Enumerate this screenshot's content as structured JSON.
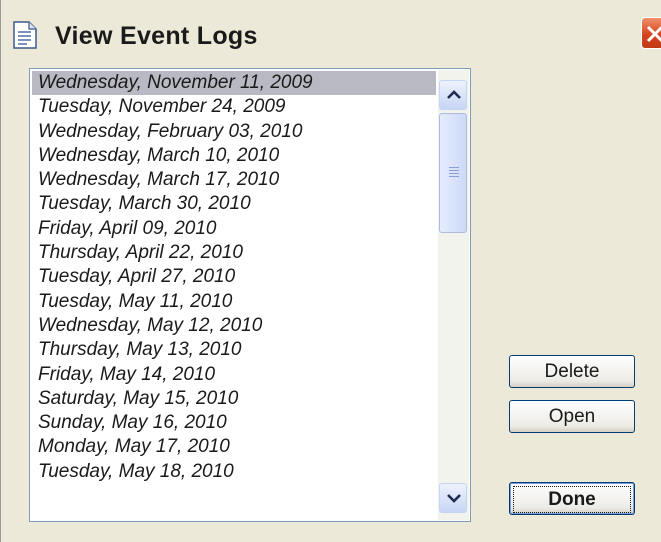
{
  "window": {
    "title": "View Event Logs"
  },
  "icons": {
    "title_icon": "document-icon",
    "close_icon": "close-x-icon",
    "scroll_up": "chevron-up-icon",
    "scroll_down": "chevron-down-icon"
  },
  "event_logs": {
    "selected_index": 0,
    "items": [
      "Wednesday, November 11, 2009",
      "Tuesday, November 24, 2009",
      "Wednesday, February 03, 2010",
      "Wednesday, March 10, 2010",
      "Wednesday, March 17, 2010",
      "Tuesday, March 30, 2010",
      "Friday, April 09, 2010",
      "Thursday, April 22, 2010",
      "Tuesday, April 27, 2010",
      "Tuesday, May 11, 2010",
      "Wednesday, May 12, 2010",
      "Thursday, May 13, 2010",
      "Friday, May 14, 2010",
      "Saturday, May 15, 2010",
      "Sunday, May 16, 2010",
      "Monday, May 17, 2010",
      "Tuesday, May 18, 2010"
    ]
  },
  "buttons": {
    "delete": "Delete",
    "open": "Open",
    "done": "Done"
  },
  "colors": {
    "selection": "#b9b9c3",
    "close_button": "#d5451f",
    "dialog_face": "#ece9d8"
  }
}
